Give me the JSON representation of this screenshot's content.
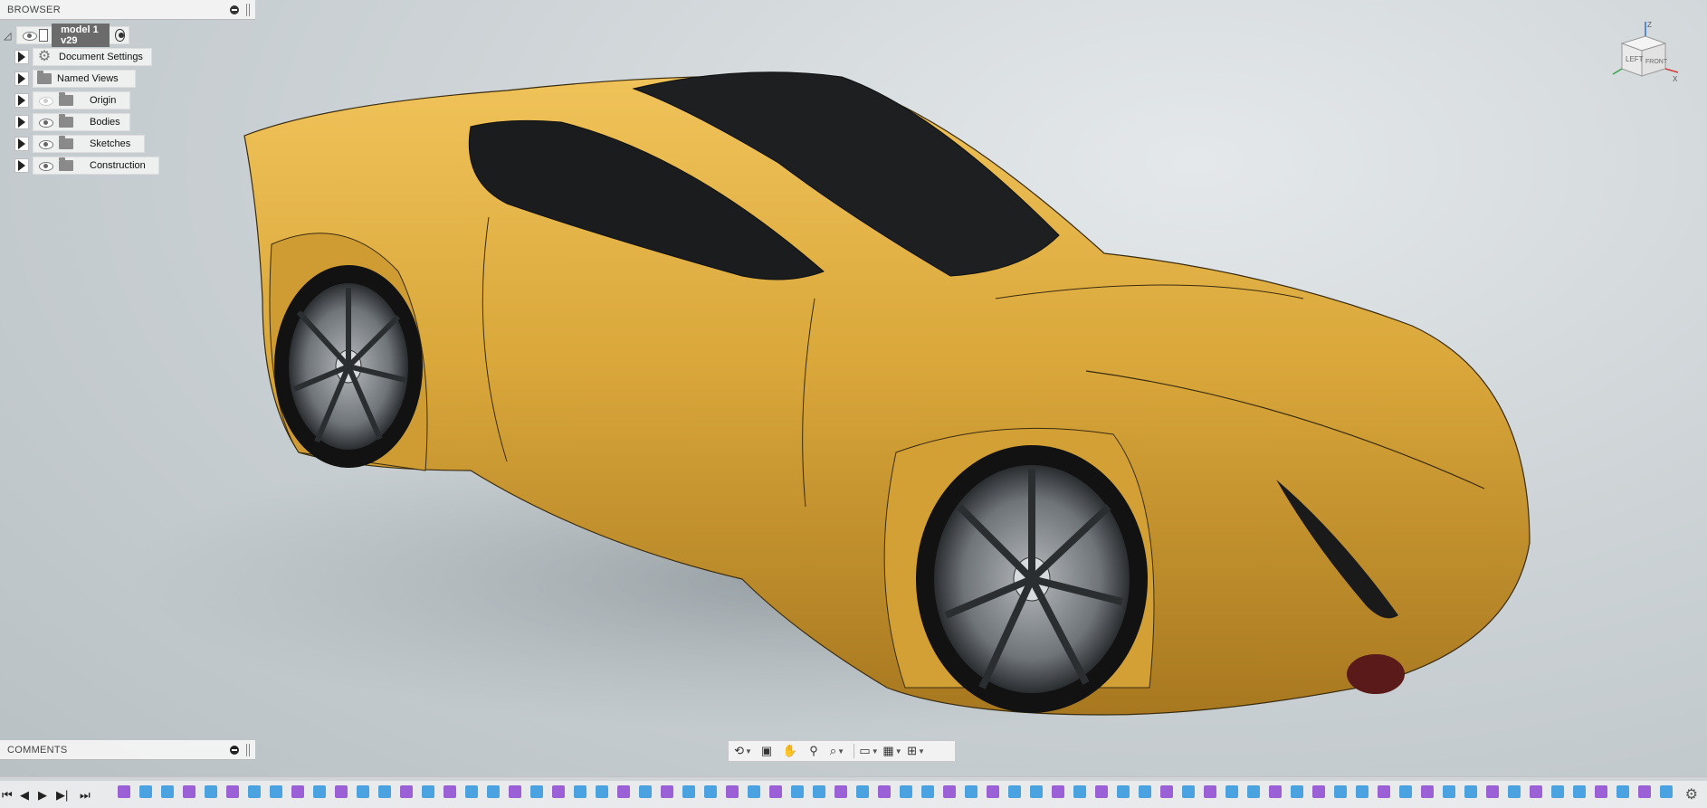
{
  "browser": {
    "title": "BROWSER",
    "root": {
      "label": "model 1 v29"
    },
    "items": [
      {
        "label": "Document Settings",
        "icon": "gear-icon",
        "visible_toggle": false
      },
      {
        "label": "Named Views",
        "icon": "folder-icon",
        "visible_toggle": false
      },
      {
        "label": "Origin",
        "icon": "folder-icon",
        "visible_toggle": true,
        "hidden": true
      },
      {
        "label": "Bodies",
        "icon": "folder-icon",
        "visible_toggle": true,
        "hidden": false
      },
      {
        "label": "Sketches",
        "icon": "folder-icon",
        "visible_toggle": true,
        "hidden": false
      },
      {
        "label": "Construction",
        "icon": "folder-icon",
        "visible_toggle": true,
        "hidden": false
      }
    ]
  },
  "comments": {
    "title": "COMMENTS"
  },
  "viewcube": {
    "left": "LEFT",
    "front": "FRONT",
    "axis_z": "Z",
    "axis_x": "X"
  },
  "nav_toolbar": {
    "tools": [
      "orbit-icon",
      "look-at-icon",
      "pan-icon",
      "zoom-icon",
      "fit-icon",
      "display-settings-icon",
      "grid-icon",
      "viewports-icon"
    ]
  },
  "timeline": {
    "controls": [
      "first-icon",
      "prev-icon",
      "play-icon",
      "next-icon",
      "last-icon"
    ],
    "feature_colors": [
      "#9b5fd6",
      "#4aa3e0",
      "#4aa3e0",
      "#9b5fd6",
      "#4aa3e0"
    ]
  },
  "colors": {
    "car_body": "#d9a73a",
    "glass": "#1f1f1f",
    "panel": "#f5f5f5"
  }
}
